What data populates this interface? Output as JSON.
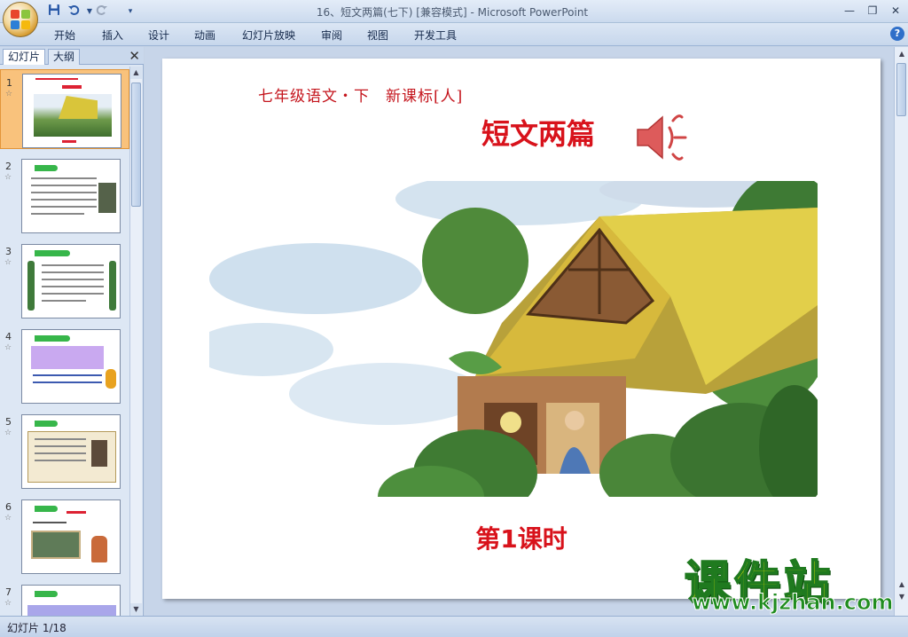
{
  "window": {
    "title": "16、短文两篇(七下) [兼容模式] - Microsoft PowerPoint"
  },
  "quick_access": {
    "save_icon": "save-icon",
    "undo_icon": "undo-icon",
    "redo_icon": "redo-icon",
    "customize_icon": "customize-icon"
  },
  "ribbon": {
    "tabs": [
      "开始",
      "插入",
      "设计",
      "动画",
      "幻灯片放映",
      "审阅",
      "视图",
      "开发工具"
    ],
    "help_label": "?"
  },
  "left_panel": {
    "tabs": [
      "幻灯片",
      "大纲"
    ],
    "close_label": "✕",
    "thumbnails": [
      {
        "number": "1",
        "selected": true
      },
      {
        "number": "2",
        "selected": false
      },
      {
        "number": "3",
        "selected": false
      },
      {
        "number": "4",
        "selected": false
      },
      {
        "number": "5",
        "selected": false
      },
      {
        "number": "6",
        "selected": false
      },
      {
        "number": "7",
        "selected": false
      }
    ]
  },
  "slide": {
    "subtitle": "七年级语文・下　新课标[人]",
    "title": "短文两篇",
    "lesson": "第1课时"
  },
  "status": {
    "slide_counter": "幻灯片 1/18"
  },
  "watermark": {
    "main": "课件站",
    "url": "www.kjzhan.com"
  },
  "colors": {
    "title_red": "#d8121b",
    "selected_thumb": "#f9c27c",
    "watermark_yellow": "#f3ee00",
    "watermark_green": "#1f8c1f"
  }
}
